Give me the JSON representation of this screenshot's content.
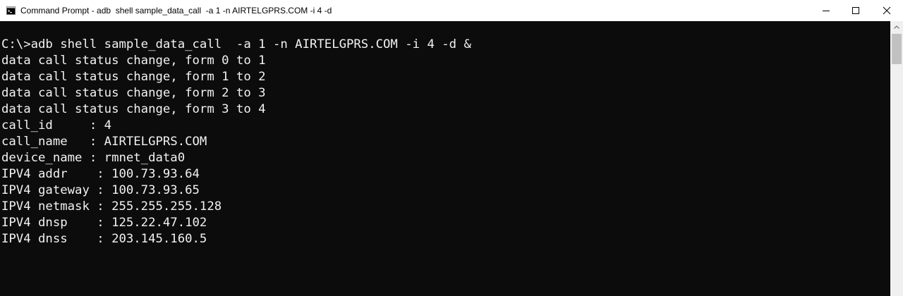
{
  "window": {
    "title": "Command Prompt - adb  shell sample_data_call  -a 1 -n AIRTELGPRS.COM -i 4 -d",
    "app_icon": "cmd-icon",
    "controls": {
      "minimize_icon": "minimize-icon",
      "maximize_icon": "maximize-icon",
      "close_icon": "close-icon"
    }
  },
  "terminal": {
    "background_color": "#0c0c0c",
    "text_color": "#f2f2f2",
    "lines": [
      "C:\\>adb shell sample_data_call  -a 1 -n AIRTELGPRS.COM -i 4 -d &",
      "data call status change, form 0 to 1",
      "data call status change, form 1 to 2",
      "data call status change, form 2 to 3",
      "data call status change, form 3 to 4",
      "call_id     : 4",
      "call_name   : AIRTELGPRS.COM",
      "device_name : rmnet_data0",
      "IPV4 addr    : 100.73.93.64",
      "IPV4 gateway : 100.73.93.65",
      "IPV4 netmask : 255.255.255.128",
      "IPV4 dnsp    : 125.22.47.102",
      "IPV4 dnss    : 203.145.160.5"
    ]
  },
  "scrollbar": {
    "up_arrow_icon": "scroll-up-arrow-icon"
  }
}
